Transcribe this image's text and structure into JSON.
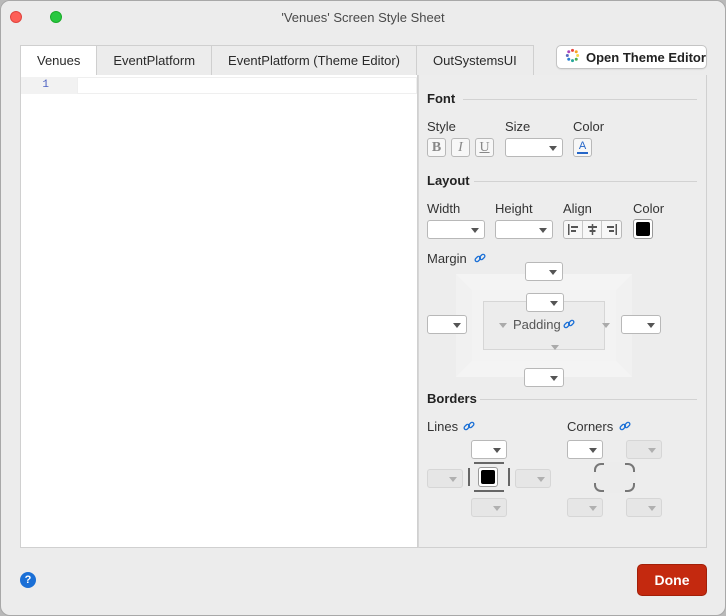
{
  "window": {
    "title": "'Venues' Screen Style Sheet"
  },
  "tabs": [
    {
      "label": "Venues",
      "active": true
    },
    {
      "label": "EventPlatform",
      "active": false
    },
    {
      "label": "EventPlatform (Theme Editor)",
      "active": false
    },
    {
      "label": "OutSystemsUI",
      "active": false
    }
  ],
  "theme_editor_button": {
    "label": "Open Theme Editor",
    "icon": "theme-palette-icon"
  },
  "editor": {
    "line_numbers": [
      "1"
    ]
  },
  "font_section": {
    "heading": "Font",
    "style_label": "Style",
    "bold": "B",
    "italic": "I",
    "underline": "U",
    "size_label": "Size",
    "size_value": "",
    "color_label": "Color",
    "color_glyph": "A"
  },
  "layout_section": {
    "heading": "Layout",
    "width_label": "Width",
    "width_value": "",
    "height_label": "Height",
    "height_value": "",
    "align_label": "Align",
    "color_label": "Color",
    "color_value": "#000000",
    "margin_label": "Margin",
    "padding_label": "Padding"
  },
  "borders_section": {
    "heading": "Borders",
    "lines_label": "Lines",
    "corners_label": "Corners",
    "line_color": "#000000"
  },
  "footer": {
    "help_glyph": "?",
    "done_label": "Done"
  },
  "colors": {
    "done_button": "#c4290f",
    "link_blue": "#1a6fd6"
  }
}
